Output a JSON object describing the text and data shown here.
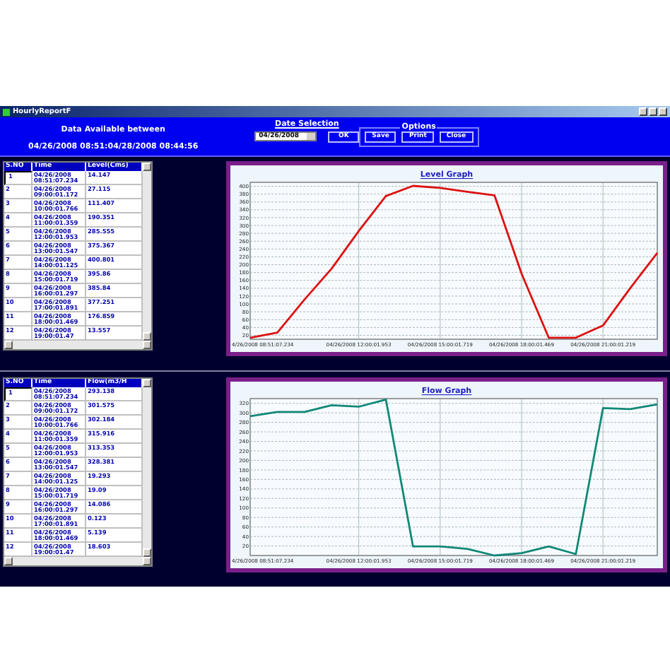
{
  "window": {
    "title": "HourlyReportF"
  },
  "header": {
    "range_label": "Data Available between",
    "range": "04/26/2008 08:51:04/28/2008 08:44:56",
    "date_label": "Date Selection",
    "date": "04/26/2008",
    "ok": "OK",
    "options_label": "Options",
    "options": [
      "Save",
      "Print",
      "Close"
    ]
  },
  "panels": [
    {
      "table": {
        "columns": [
          "S.NO",
          "Time",
          "Level(Cms)"
        ],
        "rows": [
          {
            "sno": "1",
            "time": "04/26/2008 08:51:07.234",
            "value": "14.147",
            "focused": true
          },
          {
            "sno": "2",
            "time": "04/26/2008 09:00:01.172",
            "value": "27.115",
            "focused": false
          },
          {
            "sno": "3",
            "time": "04/26/2008 10:00:01.766",
            "value": "111.407",
            "focused": false
          },
          {
            "sno": "4",
            "time": "04/26/2008 11:00:01.359",
            "value": "190.351",
            "focused": false
          },
          {
            "sno": "5",
            "time": "04/26/2008 12:00:01.953",
            "value": "285.555",
            "focused": false
          },
          {
            "sno": "6",
            "time": "04/26/2008 13:00:01.547",
            "value": "375.367",
            "focused": false
          },
          {
            "sno": "7",
            "time": "04/26/2008 14:00:01.125",
            "value": "400.801",
            "focused": false
          },
          {
            "sno": "8",
            "time": "04/26/2008 15:00:01.719",
            "value": "395.86",
            "focused": false
          },
          {
            "sno": "9",
            "time": "04/26/2008 16:00:01.297",
            "value": "385.84",
            "focused": false
          },
          {
            "sno": "10",
            "time": "04/26/2008 17:00:01.891",
            "value": "377.251",
            "focused": false
          },
          {
            "sno": "11",
            "time": "04/26/2008 18:00:01.469",
            "value": "176.859",
            "focused": false
          },
          {
            "sno": "12",
            "time": "04/26/2008 19:00:01.47",
            "value": "13.557",
            "focused": false
          }
        ]
      },
      "chart_data": {
        "type": "line",
        "title": "Level Graph",
        "categories": [
          "4/26/2008 08:51:07.234",
          null,
          null,
          null,
          "04/26/2008 12:00:01.953",
          null,
          null,
          "04/26/2008 15:00:01.719",
          null,
          null,
          "04/26/2008 18:00:01.469",
          null,
          null,
          "04/26/2008 21:00:01.219",
          null,
          null
        ],
        "series": [
          {
            "color": "#dd1111",
            "values": [
              14,
              27,
              111,
              190,
              286,
              375,
              401,
              396,
              386,
              377,
              177,
              14,
              14,
              45,
              140,
              230
            ]
          }
        ],
        "ylim": [
          10,
          410
        ],
        "grid": true,
        "yticks": [
          20,
          40,
          60,
          80,
          100,
          120,
          140,
          160,
          180,
          200,
          220,
          240,
          260,
          280,
          300,
          320,
          340,
          360,
          380,
          400
        ]
      }
    },
    {
      "table": {
        "columns": [
          "S.NO",
          "Time",
          "Flow(m3/H"
        ],
        "rows": [
          {
            "sno": "1",
            "time": "04/26/2008 08:51:07.234",
            "value": "293.138",
            "focused": true
          },
          {
            "sno": "2",
            "time": "04/26/2008 09:00:01.172",
            "value": "301.575",
            "focused": false
          },
          {
            "sno": "3",
            "time": "04/26/2008 10:00:01.766",
            "value": "302.184",
            "focused": false
          },
          {
            "sno": "4",
            "time": "04/26/2008 11:00:01.359",
            "value": "315.916",
            "focused": false
          },
          {
            "sno": "5",
            "time": "04/26/2008 12:00:01.953",
            "value": "313.353",
            "focused": false
          },
          {
            "sno": "6",
            "time": "04/26/2008 13:00:01.547",
            "value": "328.381",
            "focused": false
          },
          {
            "sno": "7",
            "time": "04/26/2008 14:00:01.125",
            "value": "19.293",
            "focused": false
          },
          {
            "sno": "8",
            "time": "04/26/2008 15:00:01.719",
            "value": "19.09",
            "focused": false
          },
          {
            "sno": "9",
            "time": "04/26/2008 16:00:01.297",
            "value": "14.086",
            "focused": false
          },
          {
            "sno": "10",
            "time": "04/26/2008 17:00:01.891",
            "value": "0.123",
            "focused": false
          },
          {
            "sno": "11",
            "time": "04/26/2008 18:00:01.469",
            "value": "5.139",
            "focused": false
          },
          {
            "sno": "12",
            "time": "04/26/2008 19:00:01.47",
            "value": "18.603",
            "focused": false
          }
        ]
      },
      "chart_data": {
        "type": "line",
        "title": "Flow Graph",
        "categories": [
          "4/26/2008 08:51:07.234",
          null,
          null,
          null,
          "04/26/2008 12:00:01.953",
          null,
          null,
          "04/26/2008 15:00:01.719",
          null,
          null,
          "04/26/2008 18:00:01.469",
          null,
          null,
          "04/26/2008 21:00:01.219",
          null,
          null
        ],
        "series": [
          {
            "color": "#118877",
            "values": [
              293,
              302,
              302,
              316,
              313,
              328,
              19,
              19,
              14,
              0,
              5,
              19,
              3,
              310,
              308,
              318
            ]
          }
        ],
        "ylim": [
          0,
          330
        ],
        "grid": true,
        "yticks": [
          20,
          40,
          60,
          80,
          100,
          120,
          140,
          160,
          180,
          200,
          220,
          240,
          260,
          280,
          300,
          320
        ]
      }
    }
  ]
}
